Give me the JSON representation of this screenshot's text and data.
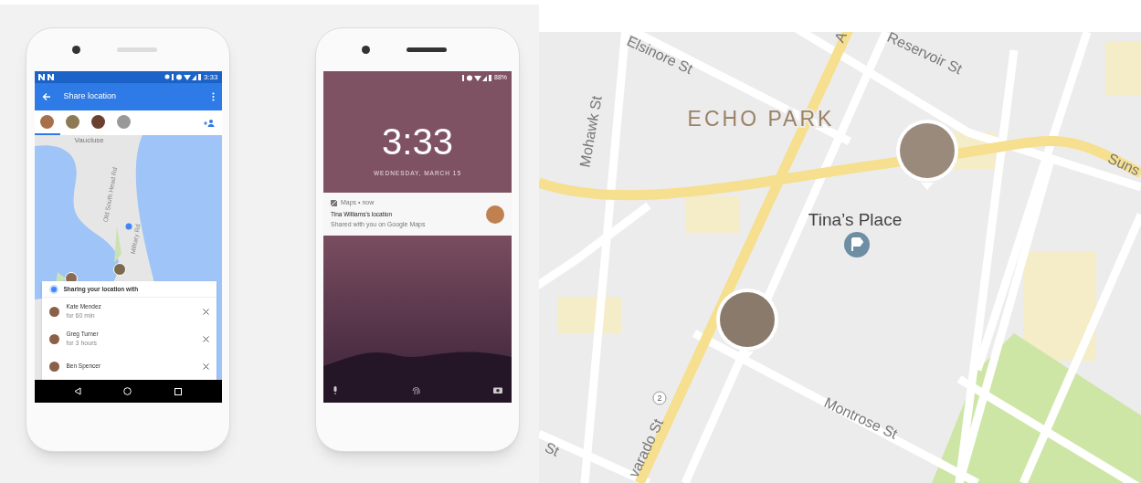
{
  "share_phone": {
    "status_time": "3:33",
    "title": "Share location",
    "avatar_tabs": [
      {
        "selected": true
      },
      {
        "selected": false
      },
      {
        "selected": false
      },
      {
        "selected": false
      }
    ],
    "map_labels": [
      "Vaucluse",
      "Old South Head Rd",
      "Military Rd"
    ],
    "sheet_heading": "Sharing your location with",
    "contacts": [
      {
        "name": "Kate Mendez",
        "duration": "for 60 min"
      },
      {
        "name": "Greg Turner",
        "duration": "for 3 hours"
      },
      {
        "name": "Ben Spencer"
      }
    ]
  },
  "lock_phone": {
    "battery": "88%",
    "time": "3:33",
    "date": "WEDNESDAY, MARCH 15",
    "notification": {
      "app": "Maps • now",
      "title": "Tina Williams's location",
      "body": "Shared with you on Google Maps"
    }
  },
  "map": {
    "labels": [
      {
        "kind": "street",
        "text": "Elsinore St"
      },
      {
        "kind": "street",
        "text": "A"
      },
      {
        "kind": "street",
        "text": "Reservoir St"
      },
      {
        "kind": "street",
        "text": "Mohawk St"
      },
      {
        "kind": "district",
        "text": "ECHO PARK"
      },
      {
        "kind": "street",
        "text": "Suns"
      },
      {
        "kind": "place",
        "text": "Tina’s Place"
      },
      {
        "kind": "shield",
        "text": "2"
      },
      {
        "kind": "street",
        "text": "Montrose St"
      },
      {
        "kind": "street",
        "text": "varado St"
      },
      {
        "kind": "street",
        "text": "St"
      }
    ]
  }
}
